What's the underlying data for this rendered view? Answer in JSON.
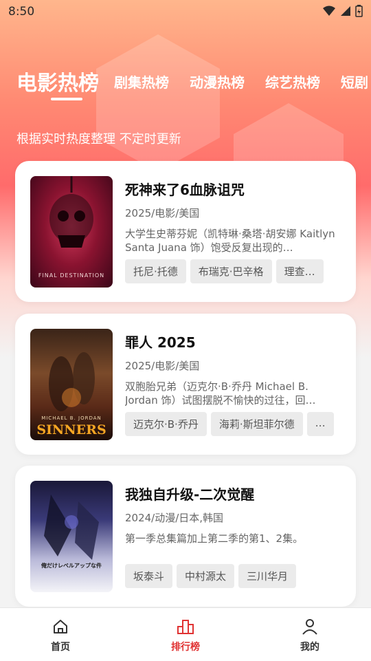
{
  "status_bar": {
    "time": "8:50"
  },
  "tabs": [
    {
      "label": "电影热榜",
      "active": true
    },
    {
      "label": "剧集热榜",
      "active": false
    },
    {
      "label": "动漫热榜",
      "active": false
    },
    {
      "label": "综艺热榜",
      "active": false
    },
    {
      "label": "短剧",
      "active": false
    }
  ],
  "subtitle": "根据实时热度整理 不定时更新",
  "cards": [
    {
      "title": "死神来了6血脉诅咒",
      "meta": "2025/电影/美国",
      "description": "大学生史蒂芬妮（凯特琳·桑塔·胡安娜 Kaitlyn Santa Juana 饰）饱受反复出现的…",
      "chips": [
        "托尼·托德",
        "布瑞克·巴辛格",
        "理查…"
      ],
      "poster_text": "FINAL DESTINATION"
    },
    {
      "title": "罪人 2025",
      "meta": "2025/电影/美国",
      "description": "双胞胎兄弟（迈克尔·B·乔丹 Michael B. Jordan 饰）试图摆脱不愉快的过往，回…",
      "chips": [
        "迈克尔·B·乔丹",
        "海莉·斯坦菲尔德",
        "…"
      ],
      "poster_text": "SINNERS",
      "poster_subtext": "MICHAEL B. JORDAN"
    },
    {
      "title": "我独自升级-二次觉醒",
      "meta": "2024/动漫/日本,韩国",
      "description": "第一季总集篇加上第二季的第1、2集。",
      "chips": [
        "坂泰斗",
        "中村源太",
        "三川华月"
      ],
      "poster_text": "俺だけレベルアップな件"
    }
  ],
  "bottom_nav": [
    {
      "label": "首页",
      "icon": "home-icon",
      "active": false
    },
    {
      "label": "排行榜",
      "icon": "ranking-icon",
      "active": true
    },
    {
      "label": "我的",
      "icon": "profile-icon",
      "active": false
    }
  ],
  "colors": {
    "accent": "#e03232",
    "hero_top": "#ffb68c",
    "hero_mid": "#ff6b6b"
  }
}
